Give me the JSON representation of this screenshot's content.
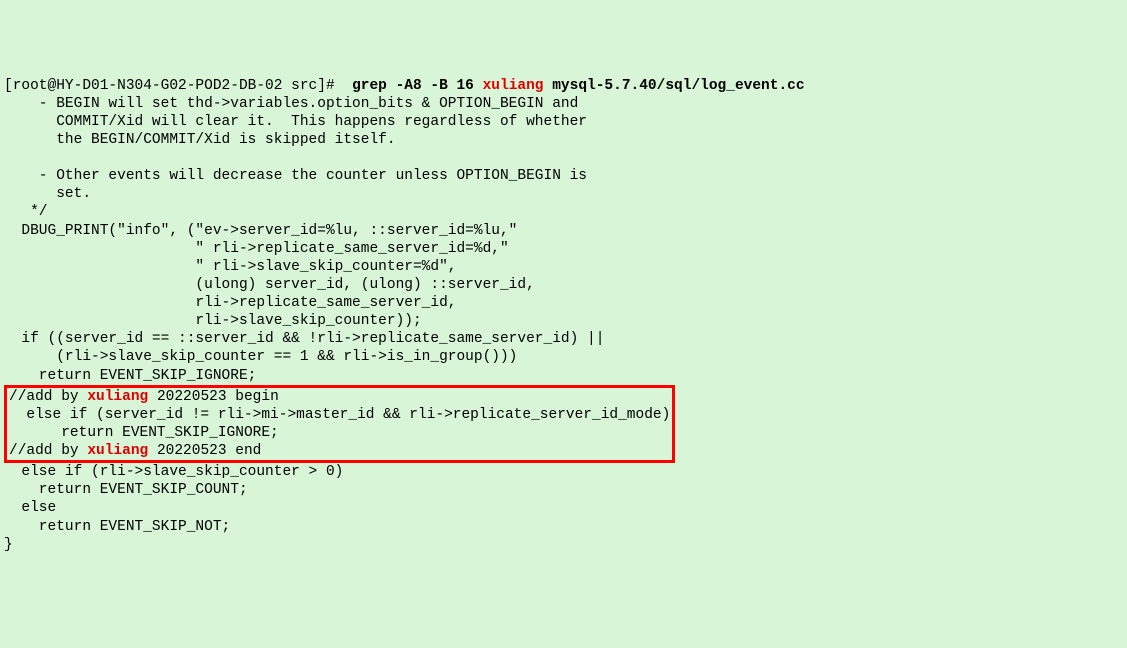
{
  "terminal": {
    "prompt": "[root@HY-D01-N304-G02-POD2-DB-02 src]#  ",
    "command": "grep -A8 -B 16 ",
    "match_word": "xuliang",
    "command_file": " mysql-5.7.40/sql/log_event.cc",
    "lines": {
      "l1": "    - BEGIN will set thd->variables.option_bits & OPTION_BEGIN and",
      "l2": "      COMMIT/Xid will clear it.  This happens regardless of whether",
      "l3": "      the BEGIN/COMMIT/Xid is skipped itself.",
      "l4": "",
      "l5": "    - Other events will decrease the counter unless OPTION_BEGIN is",
      "l6": "      set.",
      "l7": "   */",
      "l8": "  DBUG_PRINT(\"info\", (\"ev->server_id=%lu, ::server_id=%lu,\"",
      "l9": "                      \" rli->replicate_same_server_id=%d,\"",
      "l10": "                      \" rli->slave_skip_counter=%d\",",
      "l11": "                      (ulong) server_id, (ulong) ::server_id,",
      "l12": "                      rli->replicate_same_server_id,",
      "l13": "                      rli->slave_skip_counter));",
      "l14": "  if ((server_id == ::server_id && !rli->replicate_same_server_id) ||",
      "l15": "      (rli->slave_skip_counter == 1 && rli->is_in_group()))",
      "l16": "    return EVENT_SKIP_IGNORE;",
      "h1_pre": "//add by ",
      "h1_match": "xuliang",
      "h1_post": " 20220523 begin",
      "h2": "  else if (server_id != rli->mi->master_id && rli->replicate_server_id_mode)",
      "h3": "      return EVENT_SKIP_IGNORE;",
      "h4_pre": "//add by ",
      "h4_match": "xuliang",
      "h4_post": " 20220523 end",
      "l17": "  else if (rli->slave_skip_counter > 0)",
      "l18": "    return EVENT_SKIP_COUNT;",
      "l19": "  else",
      "l20": "    return EVENT_SKIP_NOT;",
      "l21": "}"
    }
  }
}
